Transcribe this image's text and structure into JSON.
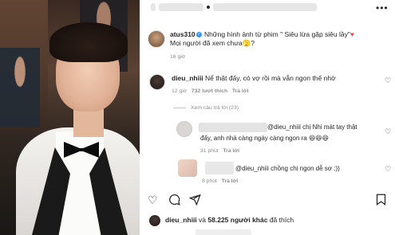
{
  "post": {
    "caption": {
      "username": "atus310",
      "text": "Những hình ảnh từ phim \" Siêu lừa gặp siêu lầy\"",
      "text2": "Mọi người đã xem chưa",
      "time": "16 giờ"
    }
  },
  "comments": [
    {
      "username": "dieu_nhiii",
      "text": "Nể thật đấy, có vợ rồi mà vẫn ngon thế nhờ",
      "time": "12 giờ",
      "likes": "732 lượt thích",
      "reply_label": "Trả lời",
      "view_replies": "Xem câu trả lời (23)"
    }
  ],
  "replies": [
    {
      "mention": "@dieu_nhiii",
      "text": "chị Nhi mát tay thật",
      "text2": "đấy, anh nhà càng ngày càng ngon ra",
      "emoji": "😆😆😆",
      "time": "31 phút",
      "reply_label": "Trả lời"
    },
    {
      "mention": "@dieu_nhiii",
      "text": "chồng chị ngon dễ sợ :))",
      "time": "8 phút",
      "reply_label": "Trả lời"
    }
  ],
  "likes_bar": {
    "username": "dieu_nhiii",
    "connector": "và",
    "count_text": "58.225 người khác",
    "suffix": "đã thích"
  },
  "icons": {
    "like": "heart-outline-icon",
    "comment": "comment-icon",
    "share": "send-icon",
    "save": "bookmark-icon",
    "more": "more-icon"
  }
}
